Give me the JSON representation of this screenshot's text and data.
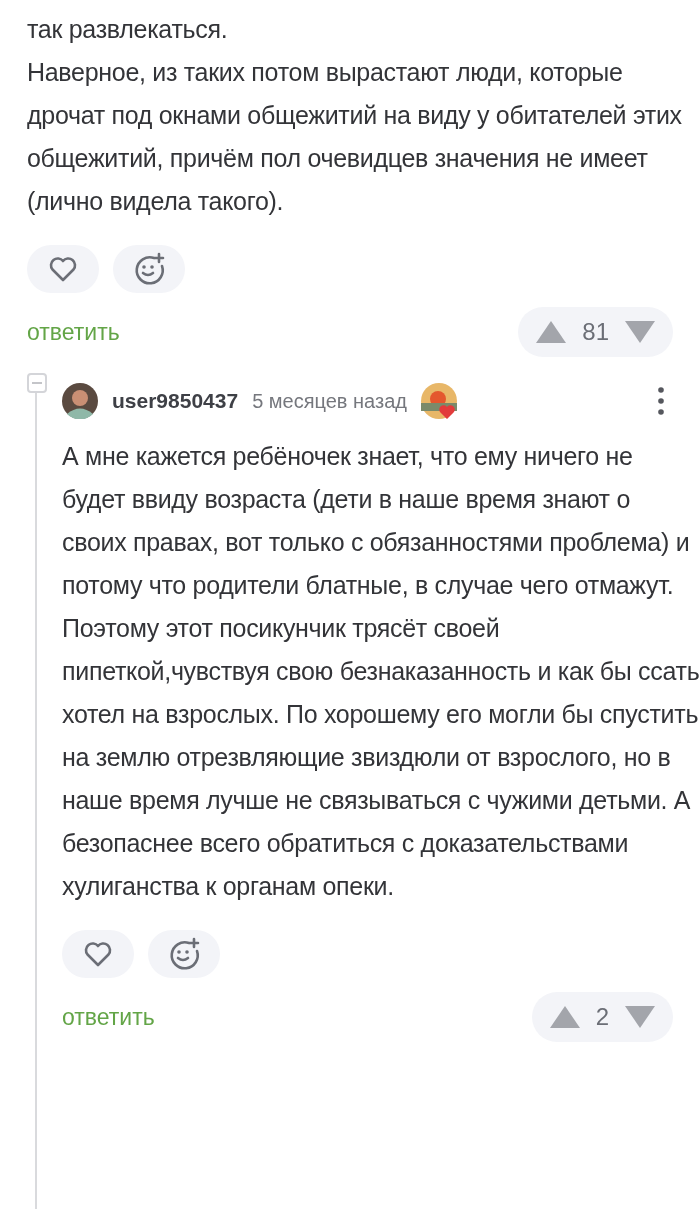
{
  "comments": [
    {
      "paragraphs": [
        "так развлекаться.",
        "Наверное, из таких потом вырастают люди, которые дрочат под окнами общежитий на виду у обитателей этих общежитий, причём пол очевидцев значения не имеет (лично видела такого)."
      ],
      "reply": "ответить",
      "score": "81"
    },
    {
      "author": "user9850437",
      "time": "5 месяцев назад",
      "paragraphs": [
        "А мне кажется ребёночек знает, что ему ничего не будет ввиду возраста (дети в наше время знают о своих правах, вот только с обязанностями проблема) и потому что родители блатные, в случае чего отмажут. Поэтому этот посикунчик трясёт своей пипеткой,чувствуя свою безнаказанность и как бы ссать хотел на взрослых. По хорошему его могли бы спустить на землю отрезвляющие звиздюли от взрослого, но в наше время лучше не связываться с чужими детьми. А безопаснее всего обратиться с доказательствами хулиганства к органам опеки."
      ],
      "reply": "ответить",
      "score": "2"
    }
  ]
}
